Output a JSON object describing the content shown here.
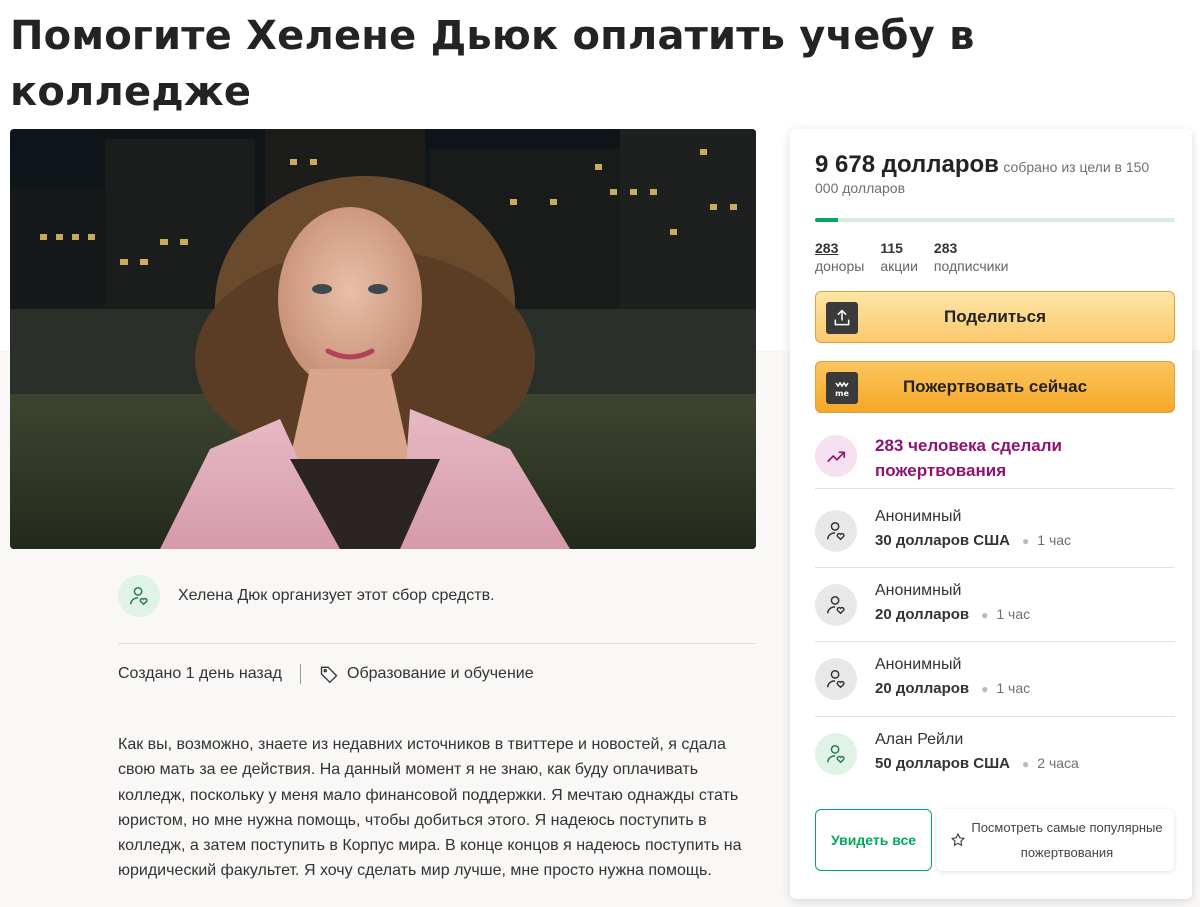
{
  "title": "Помогите Хелене Дьюк оплатить учебу в колледже",
  "organizer": {
    "text": "Хелена Дюк организует этот сбор средств."
  },
  "meta": {
    "created": "Создано 1 день назад",
    "category": "Образование и обучение"
  },
  "story": "Как вы, возможно, знаете из недавних источников в твиттере и новостей, я сдала свою мать за ее действия. На данный момент я не знаю, как буду оплачивать колледж, поскольку у меня мало финансовой поддержки. Я мечтаю однажды стать юристом, но мне нужна помощь, чтобы добиться этого. Я надеюсь поступить в колледж, а затем поступить в Корпус мира. В конце концов я надеюсь поступить на юридический факультет. Я хочу сделать мир лучше, мне просто нужна помощь.",
  "card": {
    "raised_amount": "9 678 долларов",
    "goal_text": "собрано из цели в 150 000 долларов",
    "progress_fraction": 0.0645,
    "stats": [
      {
        "value": "283",
        "label": "доноры"
      },
      {
        "value": "115",
        "label": "акции"
      },
      {
        "value": "283",
        "label": "подписчики"
      }
    ],
    "share_label": "Поделиться",
    "donate_label": "Пожертвовать сейчас",
    "donate_icon_text": "me",
    "trend_text": "283 человека сделали пожертвования",
    "donations": [
      {
        "name": "Анонимный",
        "amount": "30 долларов США",
        "time": "1 час"
      },
      {
        "name": "Анонимный",
        "amount": "20 долларов",
        "time": "1 час"
      },
      {
        "name": "Анонимный",
        "amount": "20 долларов",
        "time": "1 час"
      },
      {
        "name": "Алан Рейли",
        "amount": "50 долларов США",
        "time": "2 часа"
      }
    ],
    "see_all_label": "Увидеть все",
    "top_donations_label": "Посмотреть самые популярные пожертвования"
  },
  "colors": {
    "brand_green": "#02a95c",
    "trend_purple": "#8e1373",
    "button_amber": "#f6a827"
  }
}
